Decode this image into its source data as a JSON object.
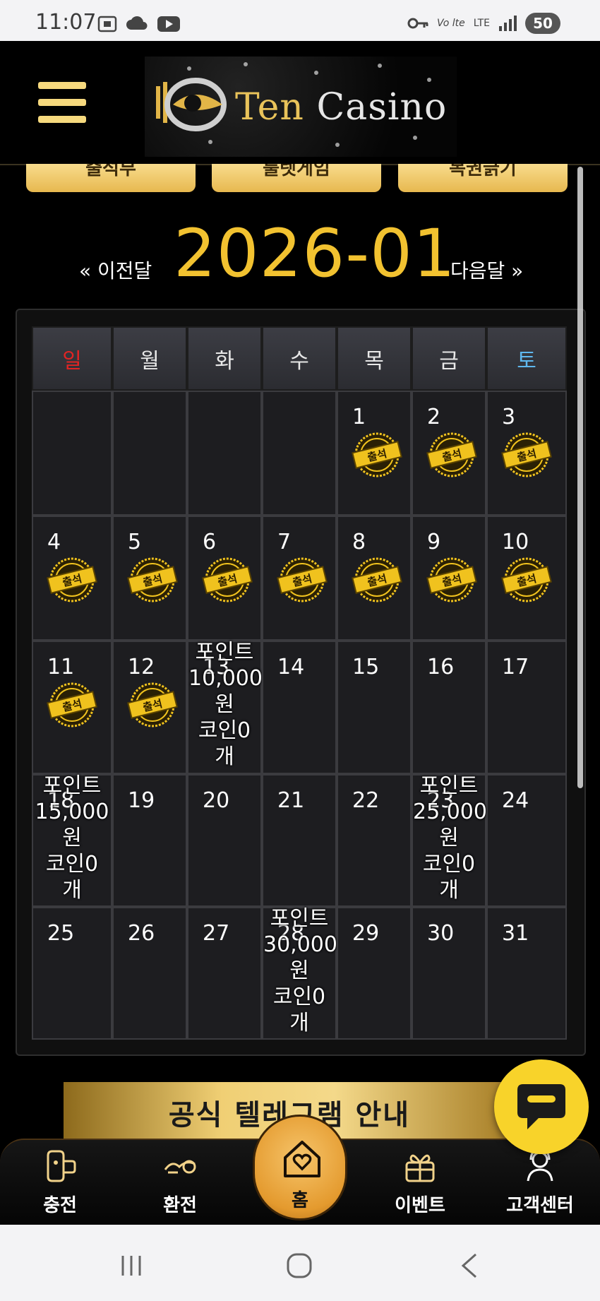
{
  "status_bar": {
    "time": "11:07",
    "lte": "LTE",
    "network_label": "Vo lte",
    "battery": "50"
  },
  "header": {
    "logo_text_ten": "Ten",
    "logo_text_casino": "Casino"
  },
  "top_buttons": [
    "출석부",
    "룰렛게임",
    "복권긁기"
  ],
  "calendar": {
    "month": "2026-01",
    "prev_label": "« 이전달",
    "next_label": "다음달 »",
    "weekdays": [
      "일",
      "월",
      "화",
      "수",
      "목",
      "금",
      "토"
    ],
    "days": [
      "1",
      "2",
      "3",
      "4",
      "5",
      "6",
      "7",
      "8",
      "9",
      "10",
      "11",
      "12",
      "13",
      "14",
      "15",
      "16",
      "17",
      "18",
      "19",
      "20",
      "21",
      "22",
      "23",
      "24",
      "25",
      "26",
      "27",
      "28",
      "29",
      "30",
      "31"
    ],
    "stamp_label": "출석",
    "attended_days": [
      1,
      2,
      3,
      4,
      5,
      6,
      7,
      8,
      9,
      10,
      11,
      12
    ],
    "rewards": [
      {
        "day": 13,
        "lines": [
          "포인트",
          "10,000",
          "원",
          "코인0",
          "개"
        ]
      },
      {
        "day": 18,
        "lines": [
          "포인트",
          "15,000",
          "원",
          "코인0",
          "개"
        ]
      },
      {
        "day": 23,
        "lines": [
          "포인트",
          "25,000",
          "원",
          "코인0",
          "개"
        ]
      },
      {
        "day": 28,
        "lines": [
          "포인트",
          "30,000",
          "원",
          "코인0",
          "개"
        ]
      }
    ]
  },
  "banner": {
    "text": "공식 텔레그램 안내"
  },
  "bottom_nav": {
    "charge": "충전",
    "exchange": "환전",
    "home": "홈",
    "event": "이벤트",
    "support": "고객센터"
  },
  "colors": {
    "accent_gold": "#f2c230",
    "sunday": "#e02424",
    "saturday": "#5fb8ef"
  }
}
